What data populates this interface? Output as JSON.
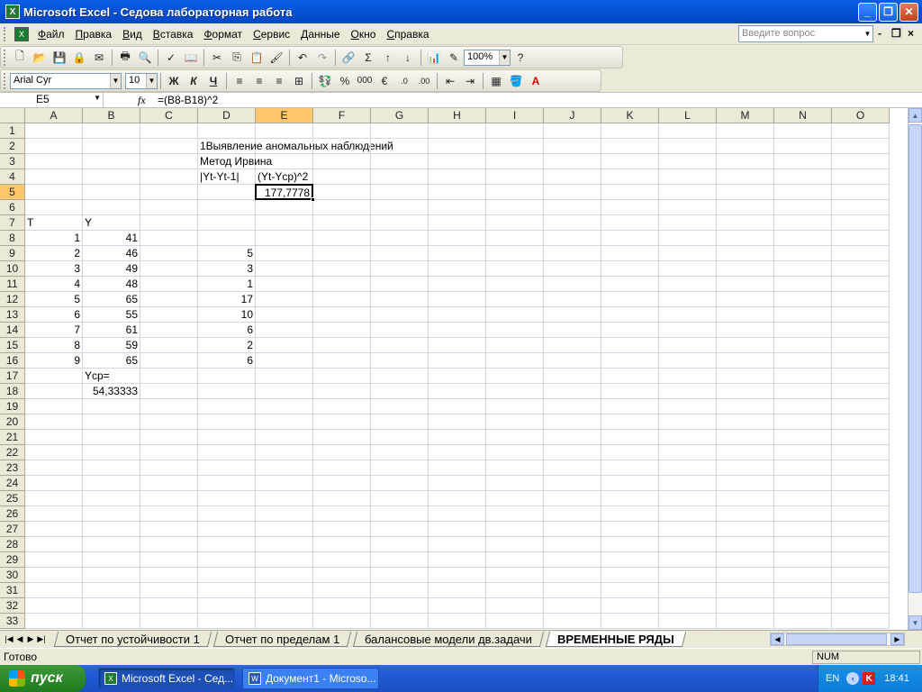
{
  "window": {
    "title": "Microsoft Excel - Седова лабораторная работа",
    "min": "_",
    "restore": "❐",
    "close": "✕"
  },
  "menu": {
    "items": [
      "Файл",
      "Правка",
      "Вид",
      "Вставка",
      "Формат",
      "Сервис",
      "Данные",
      "Окно",
      "Справка"
    ],
    "ask_placeholder": "Введите вопрос",
    "doc_min": "-",
    "doc_restore": "❐",
    "doc_close": "×"
  },
  "standard_toolbar": {
    "zoom": "100%"
  },
  "format_toolbar": {
    "font": "Arial Cyr",
    "size": "10",
    "bold": "Ж",
    "italic": "К",
    "underline": "Ч"
  },
  "formula_bar": {
    "name_box": "E5",
    "fx": "fx",
    "formula": "=(B8-B18)^2"
  },
  "columns": [
    "A",
    "B",
    "C",
    "D",
    "E",
    "F",
    "G",
    "H",
    "I",
    "J",
    "K",
    "L",
    "M",
    "N",
    "O"
  ],
  "rows": [
    "1",
    "2",
    "3",
    "4",
    "5",
    "6",
    "7",
    "8",
    "9",
    "10",
    "11",
    "12",
    "13",
    "14",
    "15",
    "16",
    "17",
    "18",
    "19",
    "20",
    "21",
    "22",
    "23",
    "24",
    "25",
    "26",
    "27",
    "28",
    "29",
    "30",
    "31",
    "32",
    "33"
  ],
  "active_cell": {
    "col": "E",
    "row": "5"
  },
  "cells": {
    "D2": "1Выявление аномальных наблюдений",
    "D3": "Метод Ирвина",
    "D4": "|Yt-Yt-1|",
    "E4": "(Yt-Ycp)^2",
    "E5": "177,7778",
    "A7": "T",
    "B7": "Y",
    "A8": "1",
    "B8": "41",
    "A9": "2",
    "B9": "46",
    "D9": "5",
    "A10": "3",
    "B10": "49",
    "D10": "3",
    "A11": "4",
    "B11": "48",
    "D11": "1",
    "A12": "5",
    "B12": "65",
    "D12": "17",
    "A13": "6",
    "B13": "55",
    "D13": "10",
    "A14": "7",
    "B14": "61",
    "D14": "6",
    "A15": "8",
    "B15": "59",
    "D15": "2",
    "A16": "9",
    "B16": "65",
    "D16": "6",
    "B17": "Ycp=",
    "B18": "54,33333"
  },
  "sheet_tabs": [
    "Отчет по устойчивости 1",
    "Отчет по пределам 1",
    "балансовые модели дв.задачи",
    "ВРЕМЕННЫЕ РЯДЫ"
  ],
  "active_sheet": "ВРЕМЕННЫЕ РЯДЫ",
  "status": {
    "text": "Готово",
    "num": "NUM"
  },
  "taskbar": {
    "start": "пуск",
    "tasks": [
      "Microsoft Excel - Сед...",
      "Документ1 - Microso..."
    ],
    "lang": "EN",
    "clock": "18:41"
  }
}
